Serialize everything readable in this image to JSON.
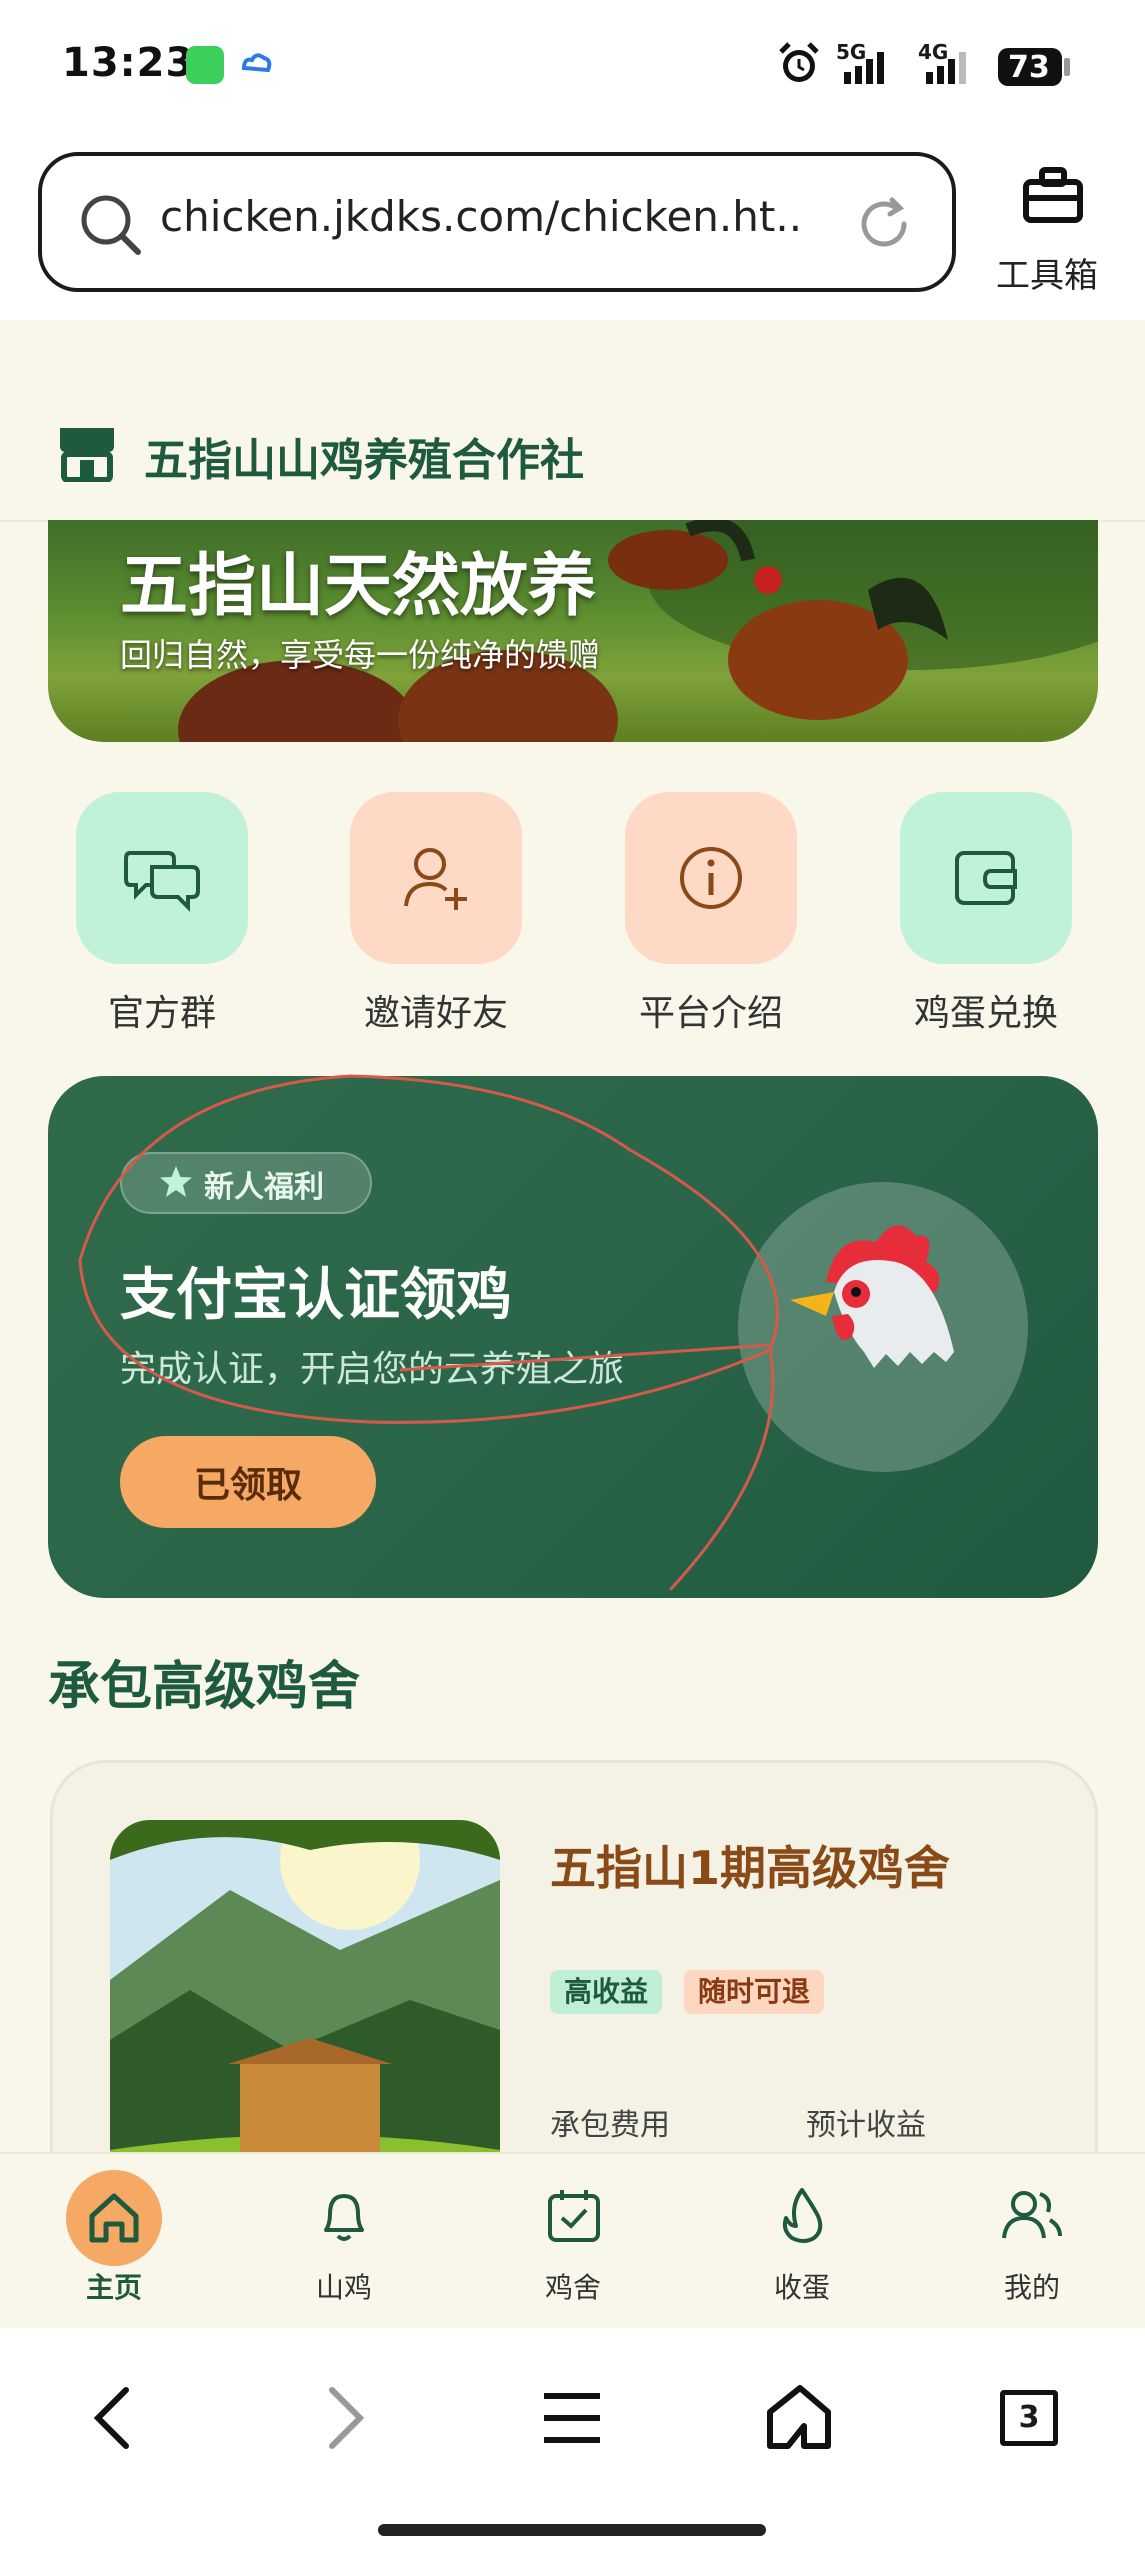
{
  "status_bar": {
    "time": "13:23",
    "signal_5g": "5G",
    "signal_4g": "4G",
    "battery": "73"
  },
  "browser": {
    "url": "chicken.jkdks.com/chicken.ht...",
    "tools_label": "工具箱"
  },
  "header": {
    "title": "五指山山鸡养殖合作社"
  },
  "banner": {
    "title": "五指山天然放养",
    "subtitle": "回归自然，享受每一份纯净的馈赠"
  },
  "quick_actions": [
    {
      "label": "官方群",
      "icon": "chat-icon",
      "bg": "#bff2d8"
    },
    {
      "label": "邀请好友",
      "icon": "add-user-icon",
      "bg": "#fdd9c6"
    },
    {
      "label": "平台介绍",
      "icon": "info-icon",
      "bg": "#fdd9c6"
    },
    {
      "label": "鸡蛋兑换",
      "icon": "wallet-icon",
      "bg": "#bff2d8"
    }
  ],
  "promo": {
    "badge": "新人福利",
    "title": "支付宝认证领鸡",
    "subtitle": "完成认证，开启您的云养殖之旅",
    "button": "已领取"
  },
  "section": {
    "title": "承包高级鸡舍"
  },
  "house": {
    "name": "五指山1期高级鸡舍",
    "tags": [
      "高收益",
      "随时可退"
    ],
    "fee_label": "承包费用",
    "income_label": "预计收益"
  },
  "tabs": [
    {
      "label": "主页",
      "icon": "home-icon",
      "active": true
    },
    {
      "label": "山鸡",
      "icon": "bell-icon",
      "active": false
    },
    {
      "label": "鸡舍",
      "icon": "calendar-check-icon",
      "active": false
    },
    {
      "label": "收蛋",
      "icon": "flame-icon",
      "active": false
    },
    {
      "label": "我的",
      "icon": "users-icon",
      "active": false
    }
  ],
  "browser_nav": {
    "tab_count": "3"
  },
  "colors": {
    "brand_green": "#1d5a3e",
    "accent_orange": "#f6a865",
    "page_bg": "#f8f7ea"
  }
}
